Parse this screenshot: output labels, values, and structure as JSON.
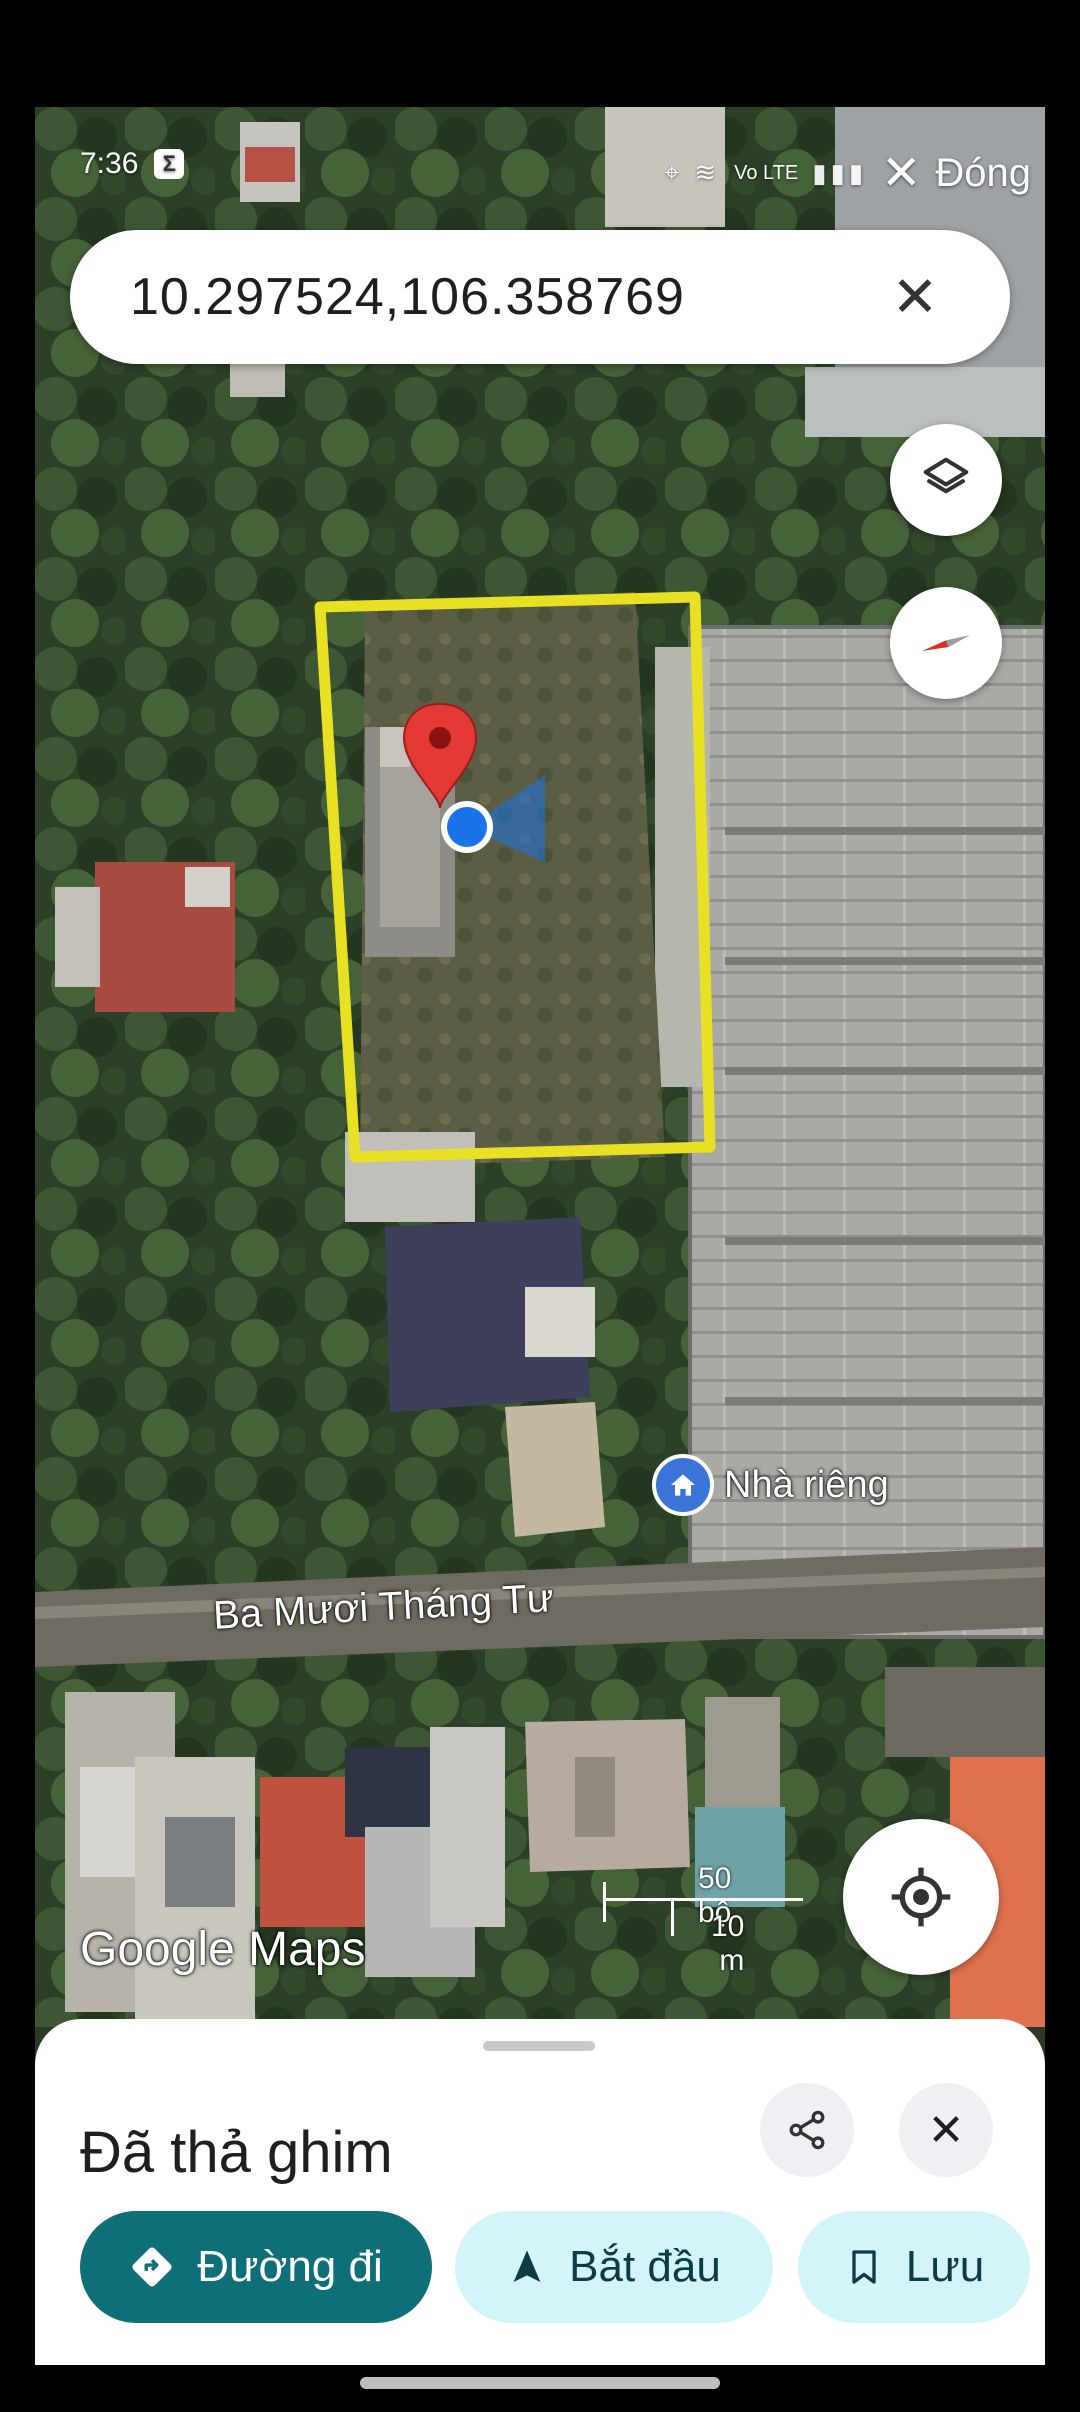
{
  "status_bar": {
    "time": "7:36",
    "sim_badge": "Σ",
    "network_label": "Vo LTE",
    "close_label": "Đóng"
  },
  "search": {
    "query": "10.297524,106.358769"
  },
  "map": {
    "street_label": "Ba Mươi Tháng Tư",
    "poi_label": "Nhà riêng",
    "brand": "Google Maps",
    "scale_primary": "50 bộ",
    "scale_secondary": "10 m",
    "highlight_color": "#e8e023",
    "pin_color": "#e53935",
    "location_dot_color": "#1a73e8"
  },
  "sheet": {
    "title": "Đã thả ghim",
    "buttons": {
      "directions": "Đường đi",
      "start": "Bắt đầu",
      "save": "Lưu"
    }
  },
  "icons": [
    "layers-icon",
    "compass-icon",
    "my-location-icon",
    "share-icon",
    "close-icon",
    "directions-icon",
    "navigation-arrow-icon",
    "bookmark-icon",
    "home-icon"
  ]
}
